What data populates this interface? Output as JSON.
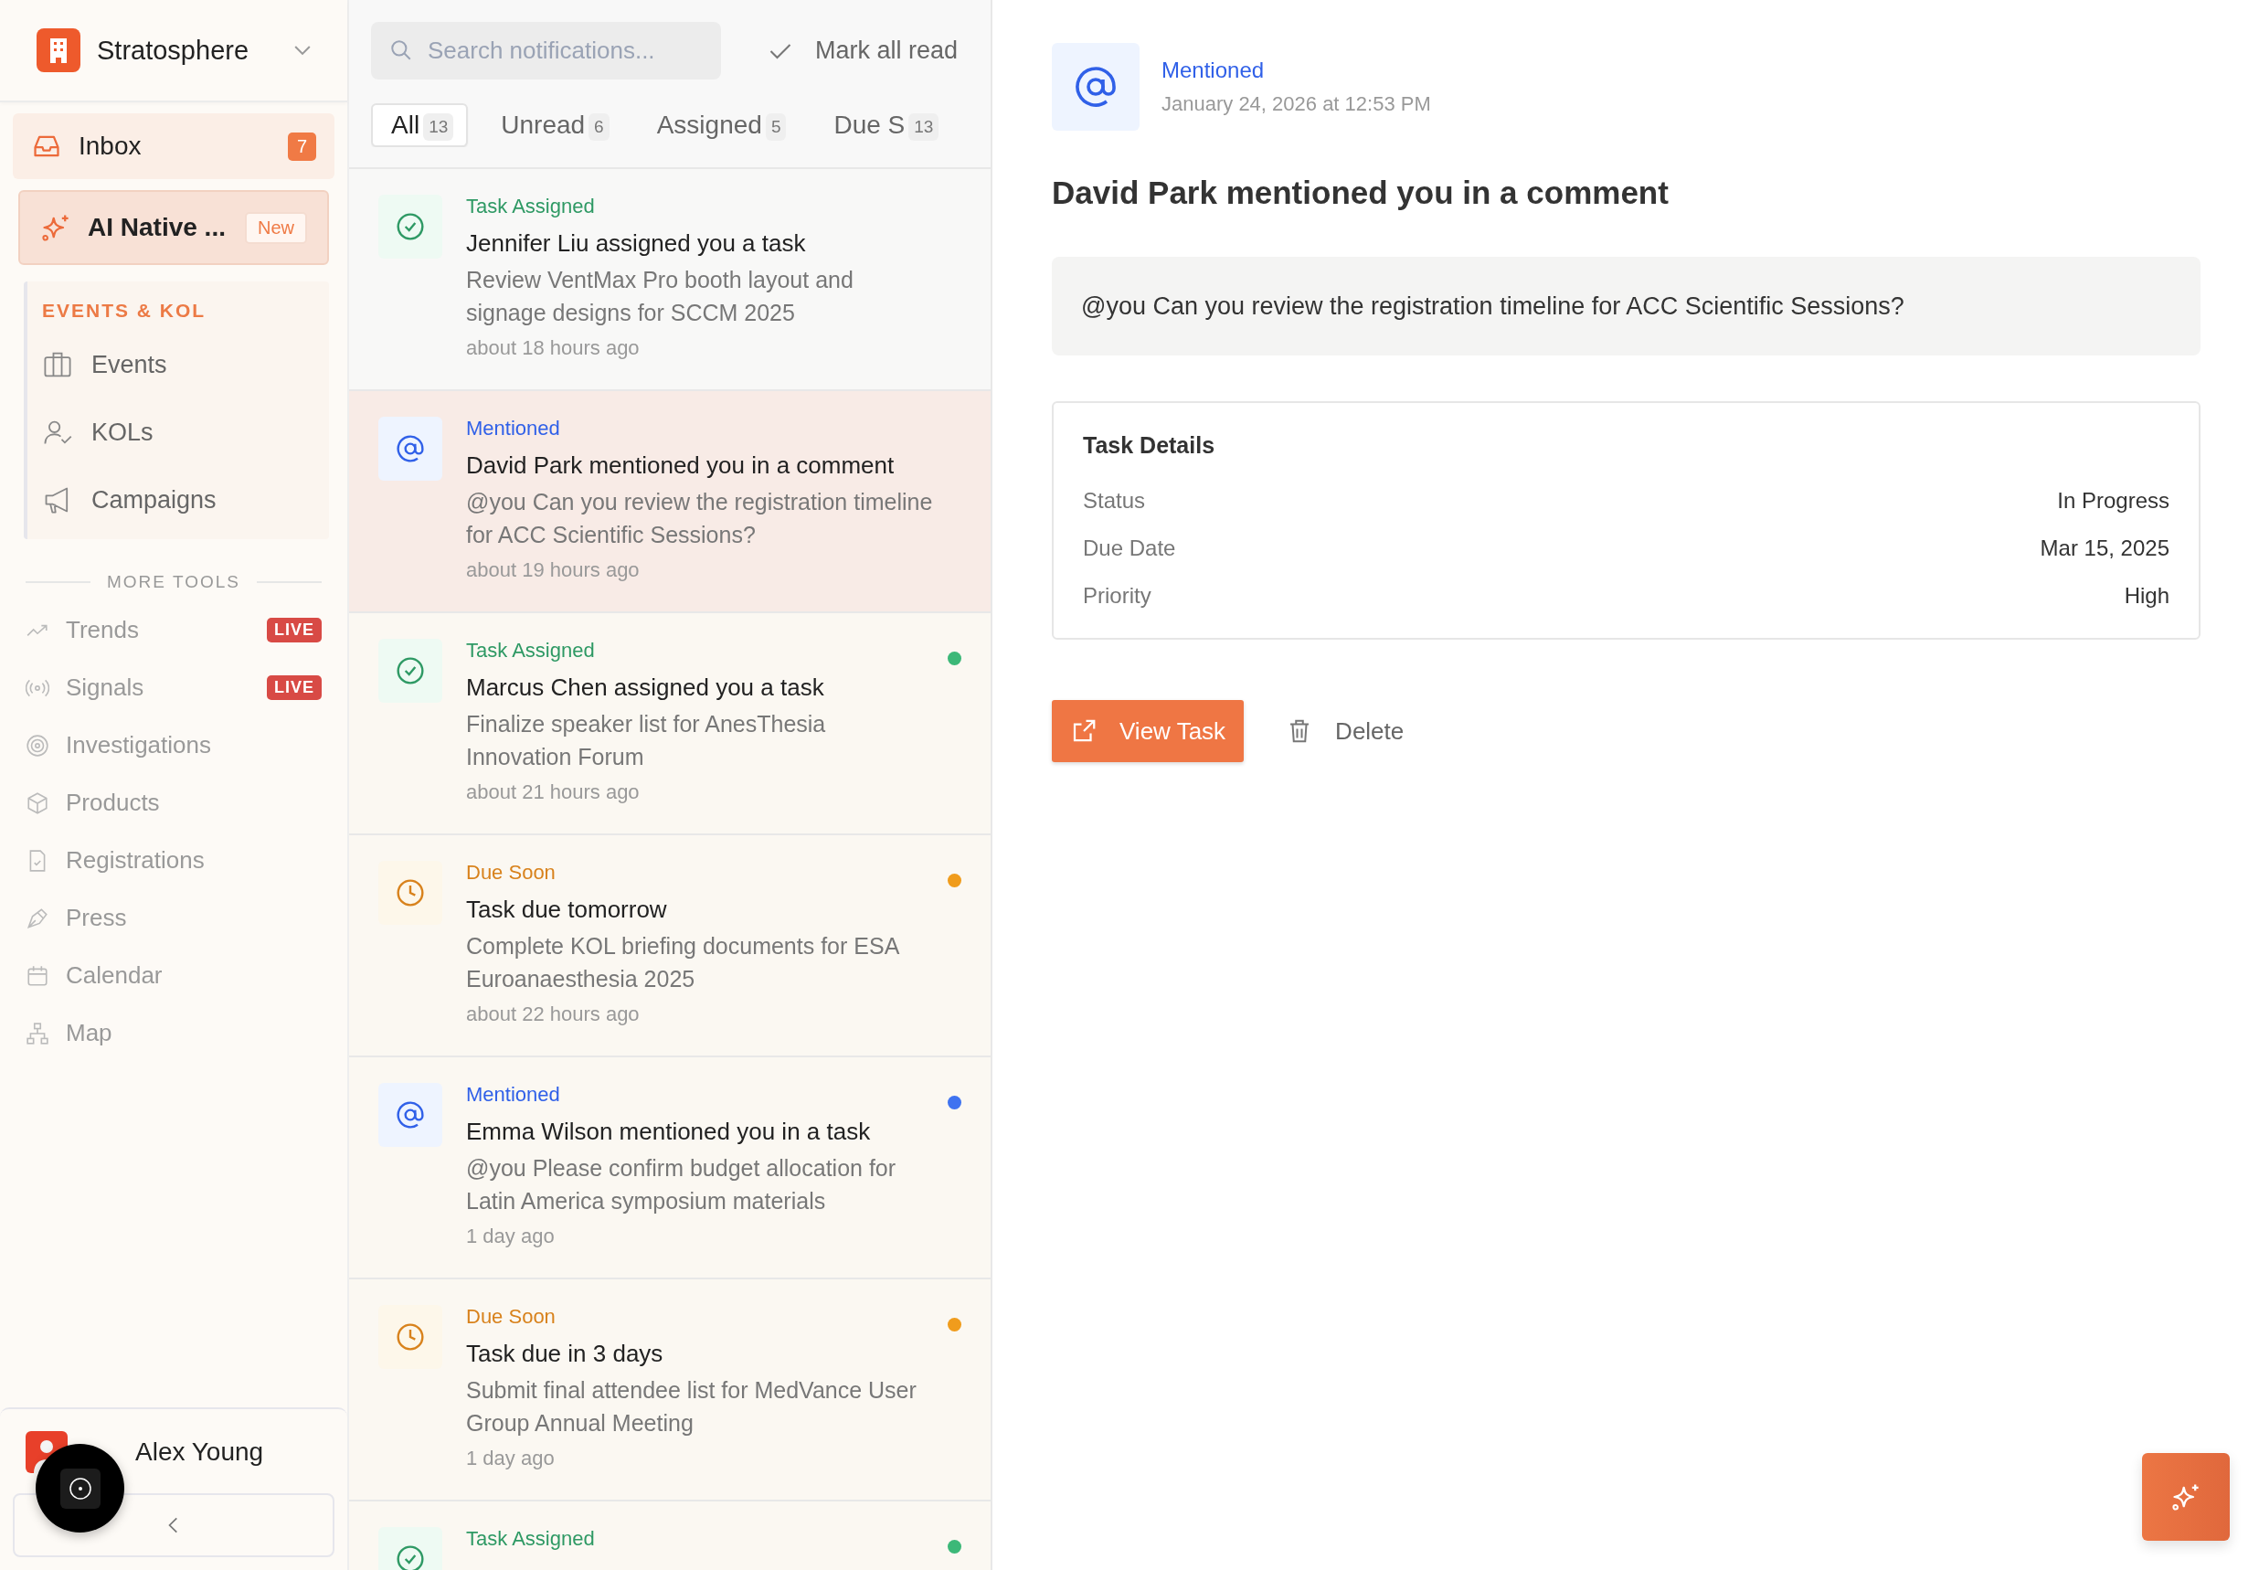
{
  "workspace": {
    "name": "Stratosphere"
  },
  "primary_nav": [
    {
      "label": "Inbox",
      "badge": "7",
      "kind": "inbox",
      "selected": true
    },
    {
      "label": "AI Native ...",
      "badge": "New",
      "kind": "featured",
      "selected": false
    }
  ],
  "section": {
    "title": "EVENTS & KOL",
    "items": [
      {
        "label": "Events"
      },
      {
        "label": "KOLs"
      },
      {
        "label": "Campaigns"
      }
    ]
  },
  "more_tools": {
    "title": "MORE TOOLS",
    "items": [
      {
        "label": "Trends",
        "badge": "LIVE"
      },
      {
        "label": "Signals",
        "badge": "LIVE"
      },
      {
        "label": "Investigations"
      },
      {
        "label": "Products"
      },
      {
        "label": "Registrations"
      },
      {
        "label": "Press"
      },
      {
        "label": "Calendar"
      },
      {
        "label": "Map"
      }
    ]
  },
  "user": {
    "name": "Alex Young"
  },
  "list": {
    "search": {
      "placeholder": "Search notifications..."
    },
    "mark_all_read": "Mark all read",
    "tabs": [
      {
        "label": "All",
        "count": "13",
        "selected": true
      },
      {
        "label": "Unread",
        "count": "6",
        "selected": false
      },
      {
        "label": "Assigned",
        "count": "5",
        "selected": false
      },
      {
        "label": "Due S",
        "count": "13",
        "selected": false
      }
    ],
    "notifications": [
      {
        "kind": "task",
        "type_label": "Task Assigned",
        "title": "Jennifer Liu assigned you a task",
        "body": "Review VentMax Pro booth layout and signage designs for SCCM 2025",
        "time": "about 18 hours ago",
        "unread": false,
        "selected": false
      },
      {
        "kind": "mention",
        "type_label": "Mentioned",
        "title": "David Park mentioned you in a comment",
        "body": "@you Can you review the registration timeline for ACC Scientific Sessions?",
        "time": "about 19 hours ago",
        "unread": false,
        "selected": true
      },
      {
        "kind": "task",
        "type_label": "Task Assigned",
        "title": "Marcus Chen assigned you a task",
        "body": "Finalize speaker list for AnesThesia Innovation Forum",
        "time": "about 21 hours ago",
        "unread": true,
        "selected": false
      },
      {
        "kind": "due",
        "type_label": "Due Soon",
        "title": "Task due tomorrow",
        "body": "Complete KOL briefing documents for ESA Euroanaesthesia 2025",
        "time": "about 22 hours ago",
        "unread": true,
        "selected": false
      },
      {
        "kind": "mention",
        "type_label": "Mentioned",
        "title": "Emma Wilson mentioned you in a task",
        "body": "@you Please confirm budget allocation for Latin America symposium materials",
        "time": "1 day ago",
        "unread": true,
        "selected": false
      },
      {
        "kind": "due",
        "type_label": "Due Soon",
        "title": "Task due in 3 days",
        "body": "Submit final attendee list for MedVance User Group Annual Meeting",
        "time": "1 day ago",
        "unread": true,
        "selected": false
      },
      {
        "kind": "task",
        "type_label": "Task Assigned",
        "unread": true,
        "selected": false
      }
    ]
  },
  "detail": {
    "kind": "mention",
    "type_label": "Mentioned",
    "date": "January 24, 2026 at 12:53 PM",
    "title": "David Park mentioned you in a comment",
    "message": "@you Can you review the registration timeline for ACC Scientific Sessions?",
    "details": {
      "title": "Task Details",
      "rows": [
        {
          "label": "Status",
          "value": "In Progress"
        },
        {
          "label": "Due Date",
          "value": "Mar 15, 2025"
        },
        {
          "label": "Priority",
          "value": "High"
        }
      ]
    },
    "actions": [
      {
        "label": "View Task",
        "kind": "primary"
      },
      {
        "label": "Delete",
        "kind": "plain"
      }
    ]
  }
}
